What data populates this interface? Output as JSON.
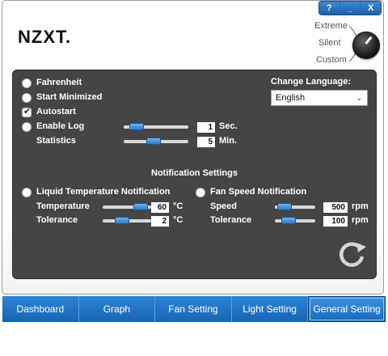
{
  "window": {
    "controls": [
      "?",
      "_",
      "X"
    ]
  },
  "header": {
    "logo": "NZXT.",
    "modes": {
      "extreme": "Extreme",
      "silent": "Silent",
      "custom": "Custom"
    }
  },
  "general": {
    "fahrenheit": {
      "label": "Fahrenheit",
      "checked": false
    },
    "start_minimized": {
      "label": "Start Minimized",
      "checked": false
    },
    "autostart": {
      "label": "Autostart",
      "checked": true
    },
    "enable_log": {
      "label": "Enable Log",
      "checked": false,
      "value": "1",
      "unit": "Sec.",
      "level": 0.12
    },
    "statistics": {
      "label": "Statistics",
      "value": "5",
      "unit": "Min.",
      "level": 0.45
    }
  },
  "language": {
    "label": "Change Language:",
    "selected": "English"
  },
  "notifications": {
    "title": "Notification Settings",
    "liquid": {
      "label": "Liquid Temperature Notification",
      "checked": false,
      "temperature": {
        "label": "Temperature",
        "value": "60",
        "unit": "°C",
        "level": 0.9
      },
      "tolerance": {
        "label": "Tolerance",
        "value": "2",
        "unit": "°C",
        "level": 0.35
      }
    },
    "fan": {
      "label": "Fan Speed Notification",
      "checked": false,
      "speed": {
        "label": "Speed",
        "value": "500",
        "unit": "rpm",
        "level": 0.1
      },
      "tolerance": {
        "label": "Tolerance",
        "value": "100",
        "unit": "rpm",
        "level": 0.25
      }
    }
  },
  "tabs": [
    {
      "label": "Dashboard",
      "active": false
    },
    {
      "label": "Graph",
      "active": false
    },
    {
      "label": "Fan Setting",
      "active": false
    },
    {
      "label": "Light Setting",
      "active": false
    },
    {
      "label": "General Setting",
      "active": true
    }
  ],
  "colors": {
    "accent": "#1f6dbd",
    "panel": "#454545"
  }
}
